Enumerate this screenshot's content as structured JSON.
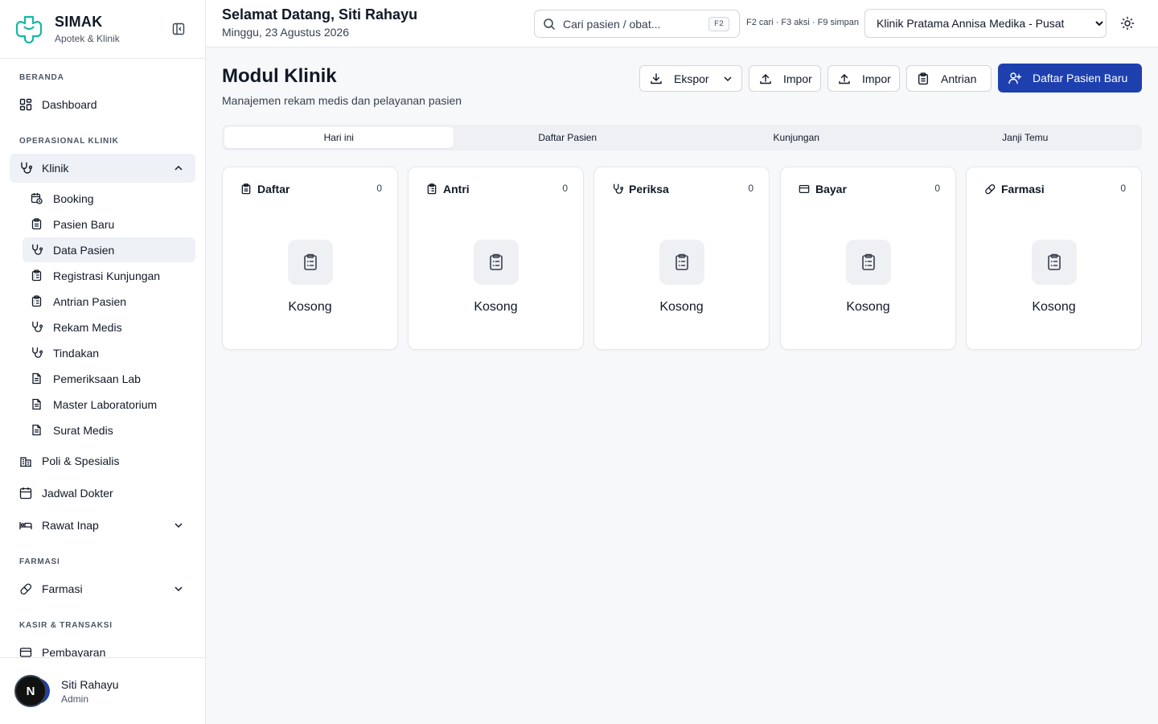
{
  "brand": {
    "name": "SIMAK",
    "subtitle": "Apotek & Klinik",
    "accent": "#14b8a6"
  },
  "sidebar": {
    "sections": {
      "beranda": "BERANDA",
      "operasional": "OPERASIONAL KLINIK",
      "farmasi": "FARMASI",
      "kasir": "KASIR & TRANSAKSI"
    },
    "items": {
      "dashboard": "Dashboard",
      "klinik": "Klinik",
      "poli": "Poli & Spesialis",
      "jadwal": "Jadwal Dokter",
      "rawat_inap": "Rawat Inap",
      "farmasi": "Farmasi",
      "pembayaran": "Pembayaran"
    },
    "klinik_sub": [
      "Booking",
      "Pasien Baru",
      "Data Pasien",
      "Registrasi Kunjungan",
      "Antrian Pasien",
      "Rekam Medis",
      "Tindakan",
      "Pemeriksaan Lab",
      "Master Laboratorium",
      "Surat Medis"
    ],
    "active_sub": "Data Pasien"
  },
  "user": {
    "name": "Siti Rahayu",
    "role": "Admin",
    "avatar_initial": "N"
  },
  "header": {
    "greeting": "Selamat Datang, Siti Rahayu",
    "date": "Minggu, 23 Agustus 2026",
    "search_placeholder": "Cari pasien / obat...",
    "search_kbd": "F2",
    "shortcuts": "F2 cari · F3 aksi · F9 simpan",
    "clinic_selected": "Klinik Pratama Annisa Medika - Pusat"
  },
  "page": {
    "title": "Modul Klinik",
    "subtitle": "Manajemen rekam medis dan pelayanan pasien",
    "buttons": {
      "export": "Ekspor",
      "import1": "Impor",
      "import2": "Impor",
      "queue": "Antrian",
      "register": "Daftar Pasien Baru"
    },
    "primary_color": "#1e40af",
    "tabs": [
      "Hari ini",
      "Daftar Pasien",
      "Kunjungan",
      "Janji Temu"
    ],
    "active_tab": "Hari ini",
    "columns": [
      {
        "title": "Daftar",
        "count": "0",
        "empty": "Kosong",
        "icon": "clipboard-icon"
      },
      {
        "title": "Antri",
        "count": "0",
        "empty": "Kosong",
        "icon": "clipboard-list-icon"
      },
      {
        "title": "Periksa",
        "count": "0",
        "empty": "Kosong",
        "icon": "stethoscope-icon"
      },
      {
        "title": "Bayar",
        "count": "0",
        "empty": "Kosong",
        "icon": "credit-card-icon"
      },
      {
        "title": "Farmasi",
        "count": "0",
        "empty": "Kosong",
        "icon": "pill-icon"
      }
    ]
  }
}
